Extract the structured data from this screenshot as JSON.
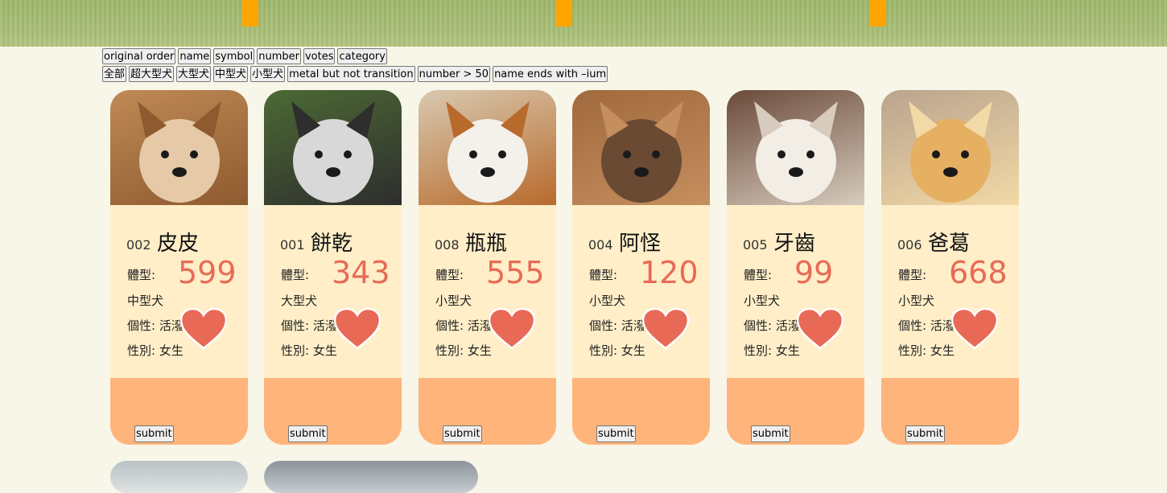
{
  "sort_buttons": [
    "original order",
    "name",
    "symbol",
    "number",
    "votes",
    "category"
  ],
  "filter_buttons": [
    "全部",
    "超大型犬",
    "大型犬",
    "中型犬",
    "小型犬",
    "metal but not transition",
    "number > 50",
    "name ends with –ium"
  ],
  "cards": [
    {
      "number": "002",
      "name": "皮皮",
      "size_label": "體型:",
      "votes": "599",
      "size": "中型犬",
      "personality": "個性: 活潑",
      "gender": "性別: 女生",
      "submit": "submit",
      "photo_colors": [
        "#c08a56",
        "#e6c9a6",
        "#8e5a2f"
      ]
    },
    {
      "number": "001",
      "name": "餅乾",
      "size_label": "體型:",
      "votes": "343",
      "size": "大型犬",
      "personality": "個性: 活潑",
      "gender": "性別: 女生",
      "submit": "submit",
      "photo_colors": [
        "#4c6a34",
        "#d8d8d8",
        "#2e2e2e"
      ]
    },
    {
      "number": "008",
      "name": "瓶瓶",
      "size_label": "體型:",
      "votes": "555",
      "size": "小型犬",
      "personality": "個性: 活潑",
      "gender": "性別: 女生",
      "submit": "submit",
      "photo_colors": [
        "#d8c9b0",
        "#f4f1ea",
        "#b86a2c"
      ]
    },
    {
      "number": "004",
      "name": "阿怪",
      "size_label": "體型:",
      "votes": "120",
      "size": "小型犬",
      "personality": "個性: 活潑",
      "gender": "性別: 女生",
      "submit": "submit",
      "photo_colors": [
        "#a06a3e",
        "#6b4a33",
        "#c48e5e"
      ]
    },
    {
      "number": "005",
      "name": "牙齒",
      "size_label": "體型:",
      "votes": "99",
      "size": "小型犬",
      "personality": "個性: 活潑",
      "gender": "性別: 女生",
      "submit": "submit",
      "photo_colors": [
        "#6b4a3a",
        "#f2eee6",
        "#d6cbbd"
      ]
    },
    {
      "number": "006",
      "name": "爸葛",
      "size_label": "體型:",
      "votes": "668",
      "size": "小型犬",
      "personality": "個性: 活潑",
      "gender": "性別: 女生",
      "submit": "submit",
      "photo_colors": [
        "#b9a48e",
        "#e6b062",
        "#f2d9a6"
      ]
    }
  ],
  "colors": {
    "accent": "#e86a56",
    "card_bg": "#ffeec8",
    "card_footer": "#ffb47c",
    "banner_stake": "#ffa500",
    "page_bg": "#f8f6e9"
  }
}
